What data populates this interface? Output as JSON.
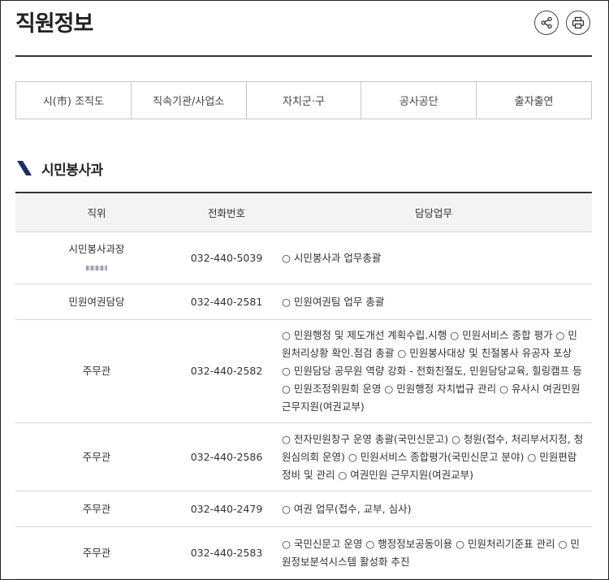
{
  "header": {
    "title": "직원정보"
  },
  "tabs": [
    "시(市) 조직도",
    "직속기관/사업소",
    "자치군·구",
    "공사공단",
    "출자출연"
  ],
  "section": {
    "title": "시민봉사과"
  },
  "table": {
    "headers": [
      "직위",
      "전화번호",
      "담당업무"
    ],
    "rows": [
      {
        "position": "시민봉사과장",
        "phone": "032-440-5039",
        "duty": "○ 시민봉사과 업무총괄",
        "h": 64
      },
      {
        "position": "민원여권담당",
        "phone": "032-440-2581",
        "duty": "○ 민원여권팀 업무 총괄",
        "h": 44
      },
      {
        "position": "주무관",
        "phone": "032-440-2582",
        "duty": "○ 민원행정 및 제도개선 계획수립.시행 ○ 민원서비스 종합 평가 ○ 민원처리상황 확인.점검 총괄 ○ 민원봉사대상 및 친절봉사 유공자 포상 ○ 민원담당 공무원 역량 강화 - 전화친절도, 민원담당교육, 힐링캠프 등 ○ 민원조정위원회 운영 ○ 민원행정 자치법규 관리 ○ 유사시 여권민원 근무지원(여권교부)",
        "h": 123
      },
      {
        "position": "주무관",
        "phone": "032-440-2586",
        "duty": "○ 전자민원창구 운영 총괄(국민신문고) ○ 청원(접수, 처리부서지정, 청원심의회 운영) ○ 민원서비스 종합평가(국민신문고 분야) ○ 민원편람 정비 및 관리 ○ 여권민원 근무지원(여권교부)",
        "h": 84
      },
      {
        "position": "주무관",
        "phone": "032-440-2479",
        "duty": "○ 여권 업무(접수, 교부, 심사)",
        "h": 44
      },
      {
        "position": "주무관",
        "phone": "032-440-2583",
        "duty": "○ 국민신문고 운영 ○ 행정정보공동이용 ○ 민원처리기준표 관리 ○ 민원정보분석시스템 활성화 추진",
        "h": 64
      }
    ]
  },
  "colors": {
    "accent": "#1a2d6b",
    "header_bg": "#f3f3f3"
  }
}
